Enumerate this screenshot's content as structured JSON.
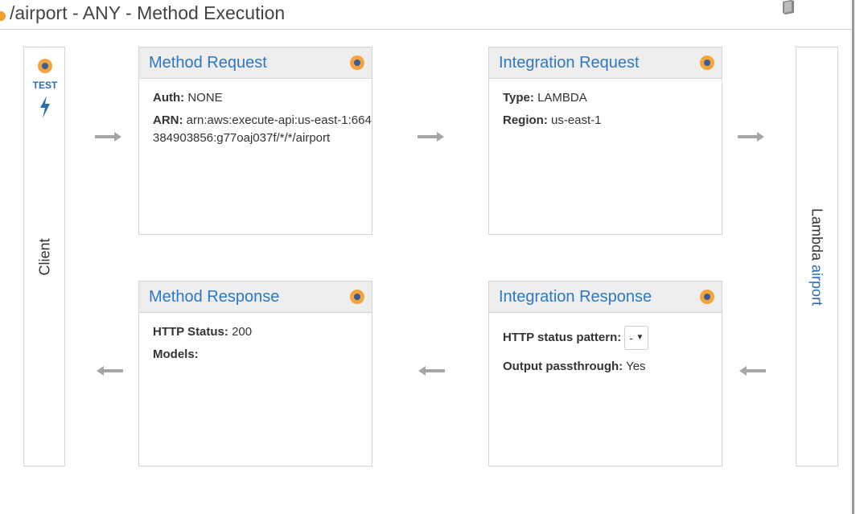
{
  "header": {
    "title": "/airport - ANY - Method Execution",
    "docs_icon": "book-icon"
  },
  "client": {
    "test_label": "TEST",
    "label": "Client",
    "icons": [
      "status-dot-icon",
      "lightning-bolt-icon"
    ]
  },
  "lambda": {
    "prefix": "Lambda",
    "function_name": "airport"
  },
  "method_request": {
    "title": "Method Request",
    "auth_label": "Auth:",
    "auth_value": "NONE",
    "arn_label": "ARN:",
    "arn_value": "arn:aws:execute-api:us-east-1:664384903856:g77oaj037f/*/*/airport"
  },
  "integration_request": {
    "title": "Integration Request",
    "type_label": "Type:",
    "type_value": "LAMBDA",
    "region_label": "Region:",
    "region_value": "us-east-1"
  },
  "method_response": {
    "title": "Method Response",
    "status_label": "HTTP Status:",
    "status_value": "200",
    "models_label": "Models:"
  },
  "integration_response": {
    "title": "Integration Response",
    "pattern_label": "HTTP status pattern:",
    "pattern_selected": "-",
    "passthrough_label": "Output passthrough:",
    "passthrough_value": "Yes"
  },
  "colors": {
    "link": "#2e78c2",
    "status_dot": "#f3a43b",
    "arrow": "#a6a6a6"
  }
}
